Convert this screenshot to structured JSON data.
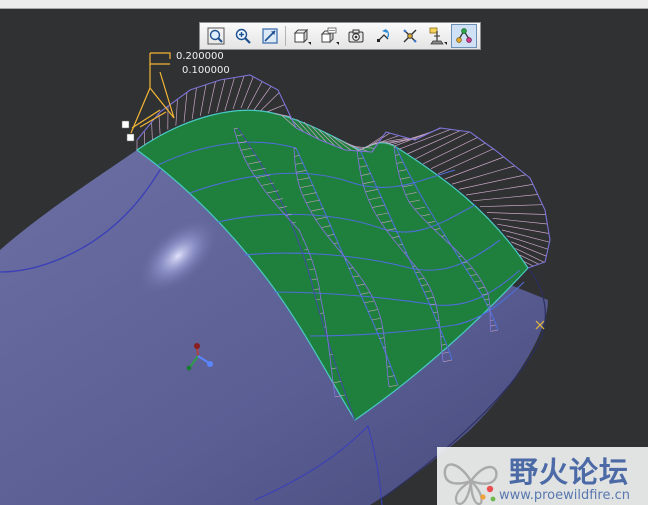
{
  "viewport": {
    "background_color": "#2f3133",
    "surface_color": "#5c6094",
    "patch_color": "#1f7f3c",
    "comb_color": "#c9a6c4",
    "envelope_color": "#7c72d6",
    "highlight_color": "#ffc43a"
  },
  "toolbar": {
    "buttons": [
      {
        "icon": "zoom-fit-icon",
        "tooltip": ""
      },
      {
        "icon": "zoom-in-icon",
        "tooltip": ""
      },
      {
        "icon": "zoom-area-icon",
        "tooltip": ""
      },
      {
        "icon": "view-orientation-icon",
        "tooltip": ""
      },
      {
        "icon": "saved-views-icon",
        "tooltip": ""
      },
      {
        "icon": "display-style-icon",
        "tooltip": ""
      },
      {
        "icon": "repaint-icon",
        "tooltip": ""
      },
      {
        "icon": "spin-center-icon",
        "tooltip": ""
      },
      {
        "icon": "datum-display-icon",
        "tooltip": ""
      },
      {
        "icon": "curvature-analysis-icon",
        "tooltip": ""
      }
    ],
    "active_index": 9
  },
  "scale_labels": {
    "upper": "0.200000",
    "lower": "0.100000"
  },
  "watermark": {
    "title": "野火论坛",
    "url": "www.proewildfire.cn"
  }
}
